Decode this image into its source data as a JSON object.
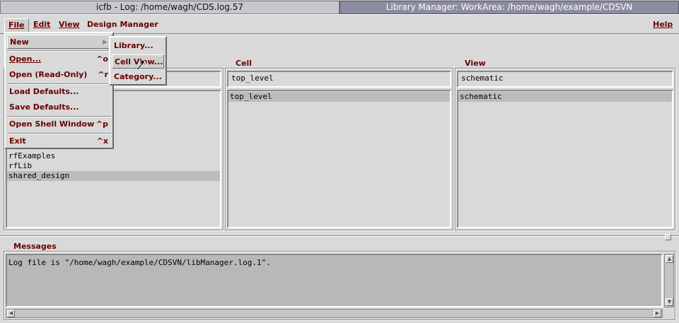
{
  "taskbar": {
    "tasks": [
      {
        "label": "icfb - Log: /home/wagh/CDS.log.57"
      },
      {
        "label": "Library Manager: WorkArea: /home/wagh/example/CDSVN"
      }
    ]
  },
  "menubar": {
    "file": "File",
    "edit": "Edit",
    "view": "View",
    "design_manager": "Design Manager",
    "help": "Help"
  },
  "file_menu": {
    "new": "New",
    "open": "Open...",
    "open_accel": "^o",
    "open_readonly": "Open (Read-Only)",
    "open_readonly_accel": "^r",
    "load_defaults": "Load Defaults...",
    "save_defaults": "Save Defaults...",
    "open_shell": "Open Shell Window",
    "open_shell_accel": "^p",
    "exit": "Exit",
    "exit_accel": "^x"
  },
  "new_submenu": {
    "library": "Library...",
    "cell_view": "Cell View...",
    "category": "Category..."
  },
  "library_panel": {
    "items": [
      "rfExamples",
      "rfLib",
      "shared_design"
    ],
    "selected_index": 2
  },
  "cell_panel": {
    "title": "Cell",
    "filter": "top_level",
    "items": [
      "top_level"
    ]
  },
  "view_panel": {
    "title": "View",
    "filter": "schematic",
    "items": [
      "schematic"
    ]
  },
  "messages": {
    "title": "Messages",
    "text": "Log file is \"/home/wagh/example/CDSVN/libManager.log.1\"."
  },
  "colors": {
    "background": "#d9d9d9",
    "menu_text": "#6b0000",
    "active_task": "#8c8ca0"
  }
}
